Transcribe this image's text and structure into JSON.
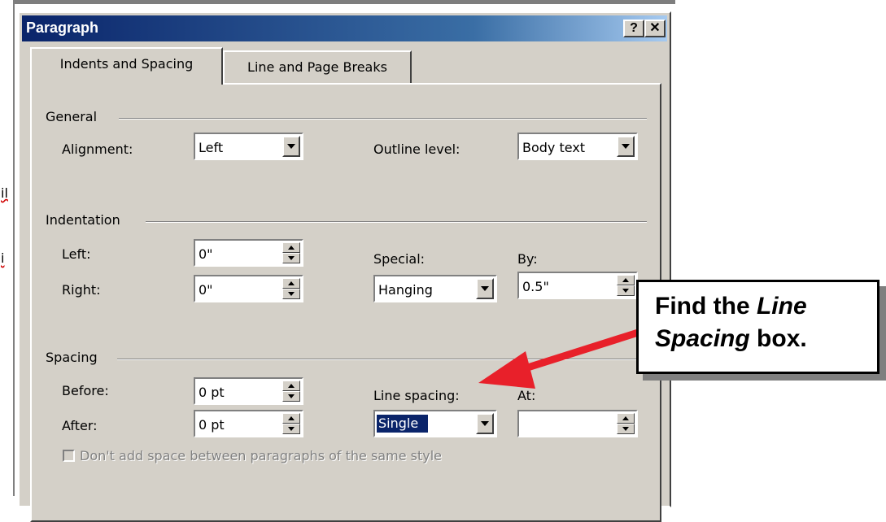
{
  "background": {
    "fragment_1": "il",
    "fragment_2": "i"
  },
  "dialog": {
    "title": "Paragraph",
    "help_btn": "?",
    "close_btn": "✕",
    "tabs": [
      {
        "label": "Indents and Spacing",
        "active": true
      },
      {
        "label": "Line and Page Breaks",
        "active": false
      }
    ],
    "general": {
      "title": "General",
      "alignment_label": "Alignment:",
      "alignment_value": "Left",
      "outline_label": "Outline level:",
      "outline_value": "Body text"
    },
    "indentation": {
      "title": "Indentation",
      "left_label": "Left:",
      "left_value": "0\"",
      "right_label": "Right:",
      "right_value": "0\"",
      "special_label": "Special:",
      "special_value": "Hanging",
      "by_label": "By:",
      "by_value": "0.5\""
    },
    "spacing": {
      "title": "Spacing",
      "before_label": "Before:",
      "before_value": "0 pt",
      "after_label": "After:",
      "after_value": "0 pt",
      "line_spacing_label": "Line spacing:",
      "line_spacing_value": "Single",
      "at_label": "At:",
      "at_value": "",
      "no_space_label": "Don't add space between paragraphs of the same style",
      "no_space_checked": false
    }
  },
  "callout": {
    "line1_prefix": "Find the ",
    "line1_italic": "Line",
    "line2_italic": "Spacing",
    "line2_suffix": " box."
  },
  "colors": {
    "dialog_bg": "#d4d0c8",
    "title_start": "#0a246a",
    "title_end": "#a6caf0",
    "arrow": "#e8202a"
  }
}
